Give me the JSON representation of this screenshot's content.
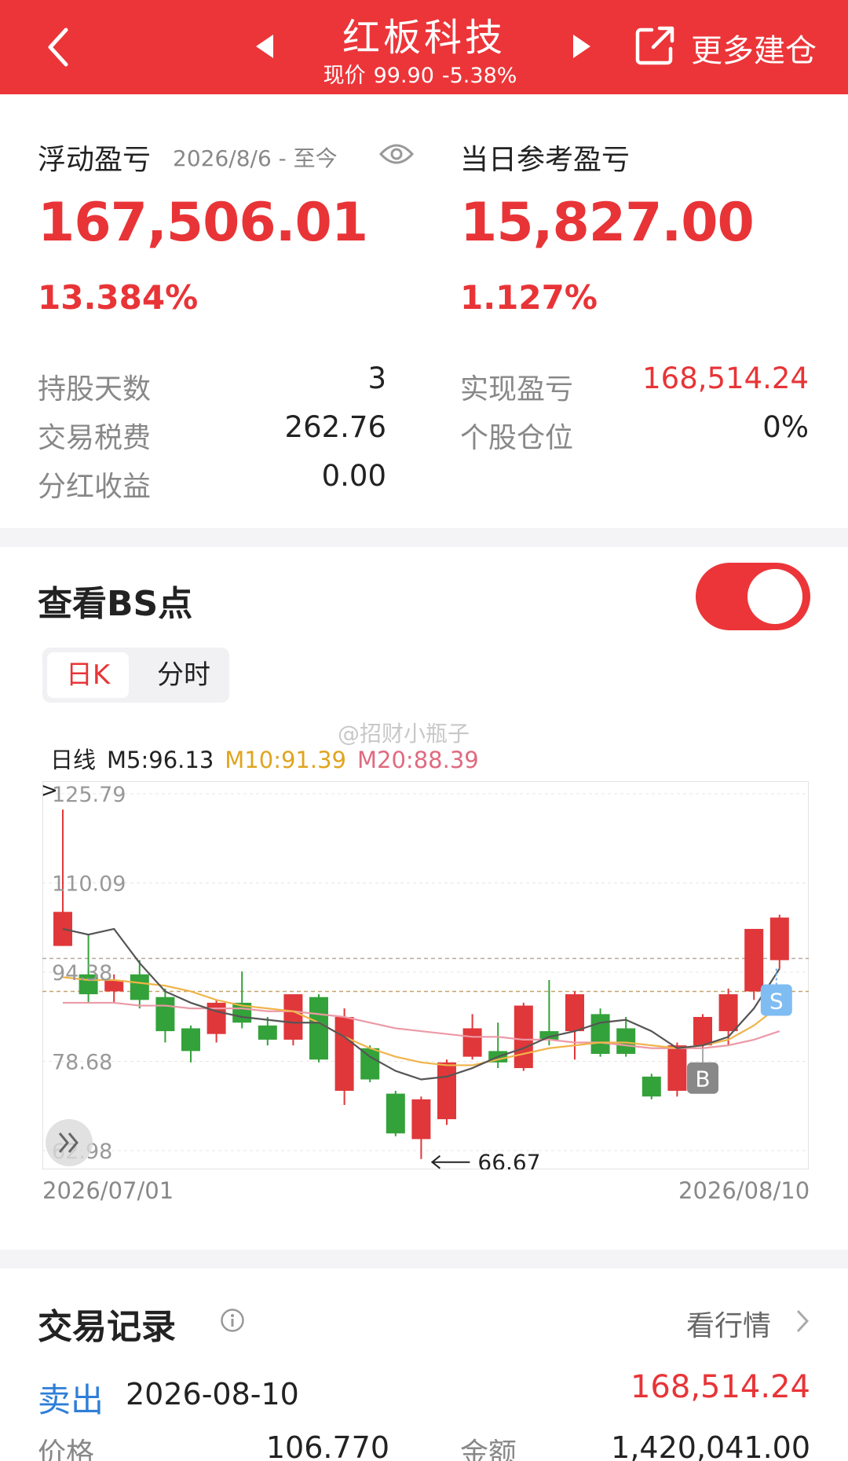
{
  "header": {
    "title": "红板科技",
    "price_label": "现价",
    "price": "99.90",
    "change": "-5.38%",
    "more_label": "更多建仓"
  },
  "summary": {
    "floating_label": "浮动盈亏",
    "floating_period": "2026/8/6 - 至今",
    "floating_value": "167,506.01",
    "floating_pct": "13.384%",
    "daily_label": "当日参考盈亏",
    "daily_value": "15,827.00",
    "daily_pct": "1.127%",
    "hold_days_label": "持股天数",
    "hold_days": "3",
    "tax_label": "交易税费",
    "tax": "262.76",
    "dividend_label": "分红收益",
    "dividend": "0.00",
    "realized_label": "实现盈亏",
    "realized": "168,514.24",
    "position_label": "个股仓位",
    "position": "0%"
  },
  "bs": {
    "title": "查看BS点",
    "toggle_on": true,
    "tab_day": "日K",
    "tab_intraday": "分时",
    "watermark": "@招财小瓶子",
    "ma_label": "日线",
    "m5": "M5:96.13",
    "m10": "M10:91.39",
    "m20": "M20:88.39",
    "min_annotation": "66.67",
    "date_start": "2026/07/01",
    "date_end": "2026/08/10",
    "buy_marker": "B",
    "sell_marker": "S"
  },
  "chart_data": {
    "type": "candlestick",
    "ylim": [
      62.98,
      125.79
    ],
    "ytick_labels": [
      "125.79",
      "110.09",
      "94.38",
      "78.68",
      "62.98"
    ],
    "candles": [
      {
        "o": 99.0,
        "c": 105.0,
        "h": 123.0,
        "l": 99.0
      },
      {
        "o": 94.0,
        "c": 90.5,
        "h": 101.0,
        "l": 89.0
      },
      {
        "o": 91.0,
        "c": 93.0,
        "h": 94.0,
        "l": 89.0
      },
      {
        "o": 94.0,
        "c": 89.5,
        "h": 96.5,
        "l": 88.0
      },
      {
        "o": 90.0,
        "c": 84.0,
        "h": 91.5,
        "l": 82.0
      },
      {
        "o": 84.5,
        "c": 80.5,
        "h": 85.0,
        "l": 78.5
      },
      {
        "o": 83.5,
        "c": 89.0,
        "h": 89.5,
        "l": 82.0
      },
      {
        "o": 89.0,
        "c": 85.5,
        "h": 94.5,
        "l": 84.5
      },
      {
        "o": 85.0,
        "c": 82.5,
        "h": 86.5,
        "l": 81.5
      },
      {
        "o": 82.5,
        "c": 90.5,
        "h": 90.5,
        "l": 81.5
      },
      {
        "o": 90.0,
        "c": 79.0,
        "h": 90.5,
        "l": 78.5
      },
      {
        "o": 73.5,
        "c": 86.5,
        "h": 88.0,
        "l": 71.0
      },
      {
        "o": 81.0,
        "c": 75.5,
        "h": 81.5,
        "l": 75.0
      },
      {
        "o": 73.0,
        "c": 66.0,
        "h": 73.5,
        "l": 65.5
      },
      {
        "o": 65.0,
        "c": 72.0,
        "h": 72.5,
        "l": 61.5
      },
      {
        "o": 68.5,
        "c": 78.5,
        "h": 79.0,
        "l": 67.5
      },
      {
        "o": 79.5,
        "c": 84.5,
        "h": 87.0,
        "l": 79.0
      },
      {
        "o": 80.5,
        "c": 78.5,
        "h": 85.5,
        "l": 77.5
      },
      {
        "o": 77.5,
        "c": 88.5,
        "h": 89.0,
        "l": 77.0
      },
      {
        "o": 84.0,
        "c": 82.5,
        "h": 93.0,
        "l": 81.5
      },
      {
        "o": 84.0,
        "c": 90.5,
        "h": 91.0,
        "l": 79.0
      },
      {
        "o": 87.0,
        "c": 80.0,
        "h": 88.0,
        "l": 79.5
      },
      {
        "o": 84.5,
        "c": 80.0,
        "h": 86.5,
        "l": 79.5
      },
      {
        "o": 76.0,
        "c": 72.5,
        "h": 76.5,
        "l": 72.0
      },
      {
        "o": 73.5,
        "c": 81.5,
        "h": 82.0,
        "l": 72.5
      },
      {
        "o": 81.5,
        "c": 86.5,
        "h": 87.0,
        "l": 81.0
      },
      {
        "o": 84.0,
        "c": 90.5,
        "h": 91.5,
        "l": 81.5
      },
      {
        "o": 91.0,
        "c": 102.0,
        "h": 102.0,
        "l": 89.5
      },
      {
        "o": 96.5,
        "c": 104.0,
        "h": 104.5,
        "l": 95.0
      }
    ],
    "ma5": [
      102.0,
      101.0,
      102.0,
      96.0,
      91.0,
      89.0,
      87.5,
      86.5,
      86.0,
      85.5,
      85.5,
      83.0,
      79.5,
      77.0,
      75.5,
      76.0,
      77.5,
      79.5,
      81.0,
      83.0,
      84.0,
      85.5,
      86.0,
      84.0,
      81.0,
      81.5,
      83.0,
      88.0,
      95.0
    ],
    "ma10": [
      93.5,
      93.0,
      93.0,
      92.5,
      92.0,
      91.0,
      89.5,
      88.5,
      88.0,
      87.5,
      85.5,
      83.0,
      81.0,
      79.5,
      78.5,
      78.0,
      78.0,
      79.0,
      80.0,
      81.0,
      81.5,
      82.0,
      82.0,
      81.5,
      81.0,
      81.5,
      82.5,
      85.0,
      88.5
    ],
    "ma20": [
      89.0,
      89.0,
      89.0,
      88.5,
      88.5,
      88.0,
      88.0,
      88.0,
      87.5,
      87.5,
      87.0,
      86.5,
      85.5,
      84.5,
      84.0,
      83.5,
      83.0,
      83.0,
      82.5,
      82.5,
      82.0,
      82.0,
      81.5,
      81.0,
      81.0,
      81.0,
      81.5,
      82.5,
      84.0
    ],
    "ref_price_1": 96.8,
    "ref_price_2": 91.0,
    "buy_index": 25,
    "sell_index": 28,
    "min_index": 14,
    "colors": {
      "up": "#e0373a",
      "down": "#34a23a",
      "ma5": "#555555",
      "ma10": "#f0b44a",
      "ma20": "#eb9aa6"
    }
  },
  "trades": {
    "title": "交易记录",
    "link_label": "看行情",
    "items": [
      {
        "type": "卖出",
        "date": "2026-08-10",
        "amount": "168,514.24",
        "price_label": "价格",
        "price": "106.770",
        "total_label": "金额",
        "total": "1,420,041.00"
      }
    ]
  },
  "colors": {
    "brand": "#ec3539",
    "gain": "#e83437",
    "sell": "#2e7fd8"
  }
}
